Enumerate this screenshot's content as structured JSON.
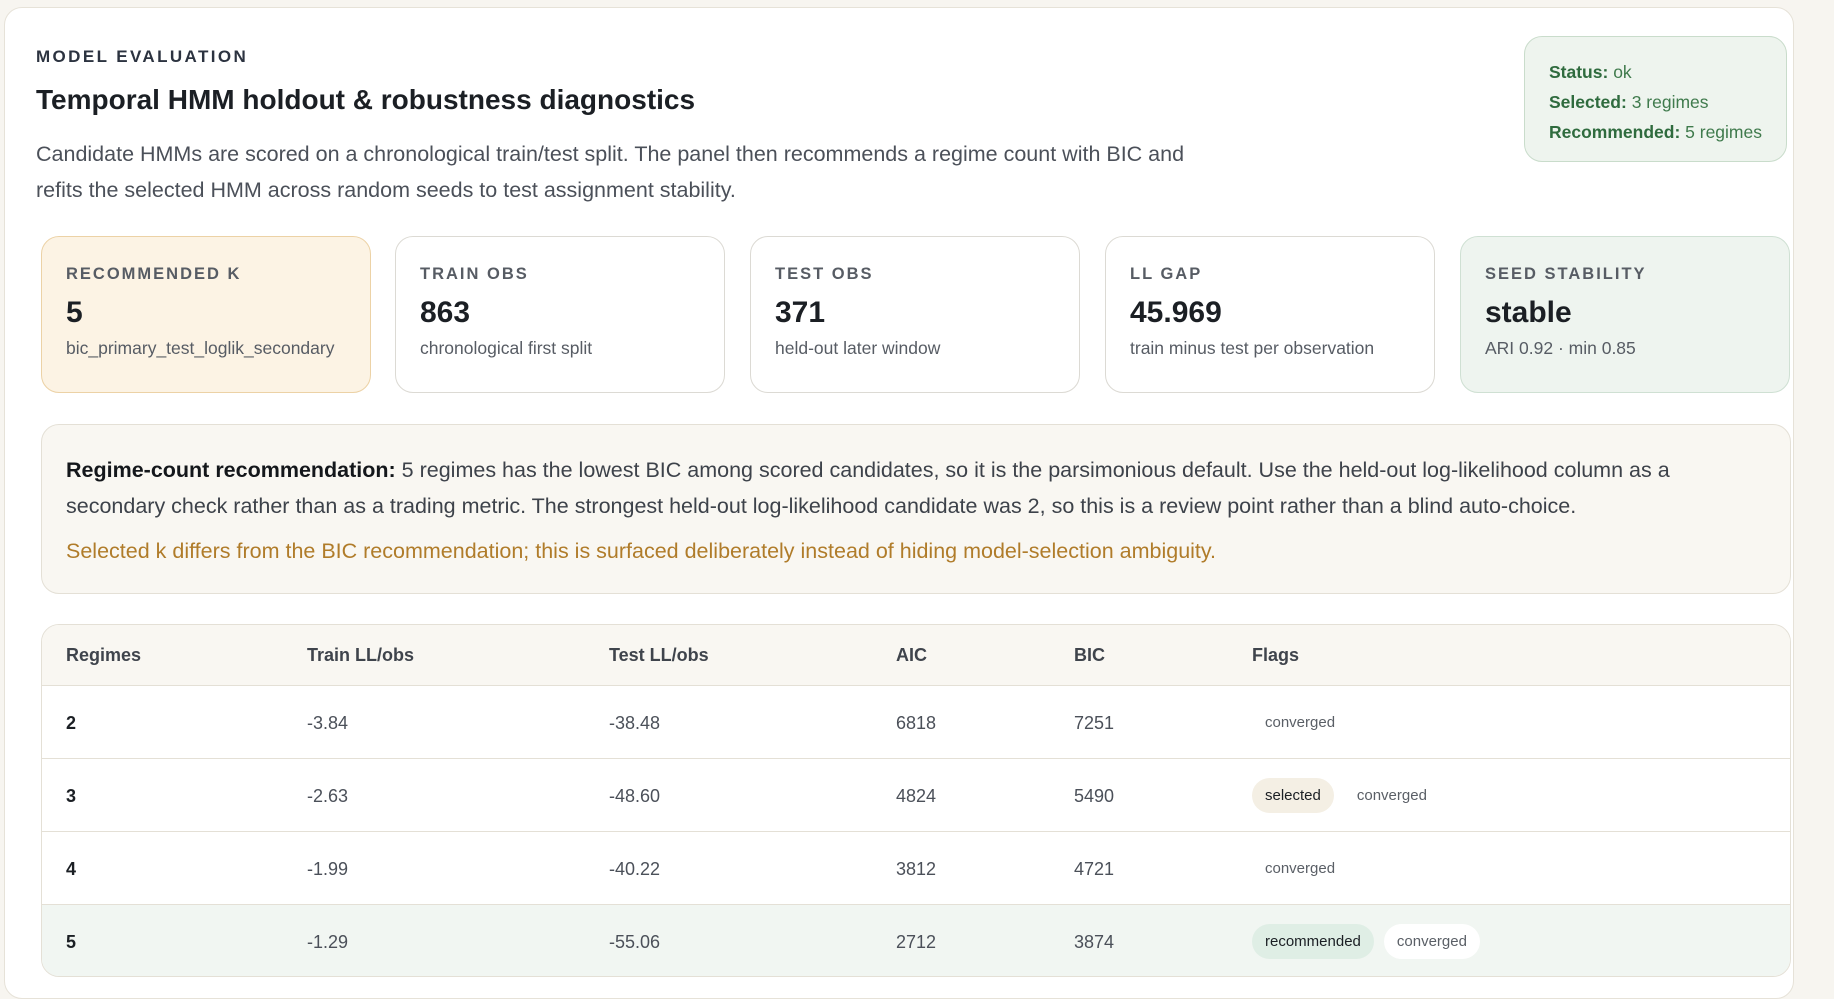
{
  "header": {
    "eyebrow": "MODEL EVALUATION",
    "title": "Temporal HMM holdout & robustness diagnostics",
    "description": "Candidate HMMs are scored on a chronological train/test split. The panel then recommends a regime count with BIC and refits the selected HMM across random seeds to test assignment stability."
  },
  "status": {
    "status_key": "Status:",
    "status_val": "ok",
    "selected_key": "Selected:",
    "selected_val": "3 regimes",
    "recommended_key": "Recommended:",
    "recommended_val": "5 regimes"
  },
  "metrics": [
    {
      "label": "RECOMMENDED K",
      "value": "5",
      "sub": "bic_primary_test_loglik_secondary"
    },
    {
      "label": "TRAIN OBS",
      "value": "863",
      "sub": "chronological first split"
    },
    {
      "label": "TEST OBS",
      "value": "371",
      "sub": "held-out later window"
    },
    {
      "label": "LL GAP",
      "value": "45.969",
      "sub": "train minus test per observation"
    },
    {
      "label": "SEED STABILITY",
      "value": "stable",
      "sub": "ARI 0.92 · min 0.85"
    }
  ],
  "recommendation": {
    "lead": "Regime-count recommendation:",
    "body": " 5 regimes has the lowest BIC among scored candidates, so it is the parsimonious default. Use the held-out log-likelihood column as a secondary check rather than as a trading metric. The strongest held-out log-likelihood candidate was 2, so this is a review point rather than a blind auto-choice.",
    "warning": "Selected k differs from the BIC recommendation; this is surfaced deliberately instead of hiding model-selection ambiguity."
  },
  "table": {
    "headers": [
      "Regimes",
      "Train LL/obs",
      "Test LL/obs",
      "AIC",
      "BIC",
      "Flags"
    ],
    "rows": [
      {
        "regimes": "2",
        "train": "-3.84",
        "test": "-38.48",
        "aic": "6818",
        "bic": "7251",
        "flags": [
          "converged"
        ]
      },
      {
        "regimes": "3",
        "train": "-2.63",
        "test": "-48.60",
        "aic": "4824",
        "bic": "5490",
        "flags": [
          "selected",
          "converged"
        ]
      },
      {
        "regimes": "4",
        "train": "-1.99",
        "test": "-40.22",
        "aic": "3812",
        "bic": "4721",
        "flags": [
          "converged"
        ]
      },
      {
        "regimes": "5",
        "train": "-1.29",
        "test": "-55.06",
        "aic": "2712",
        "bic": "3874",
        "flags": [
          "recommended",
          "converged"
        ]
      }
    ]
  }
}
